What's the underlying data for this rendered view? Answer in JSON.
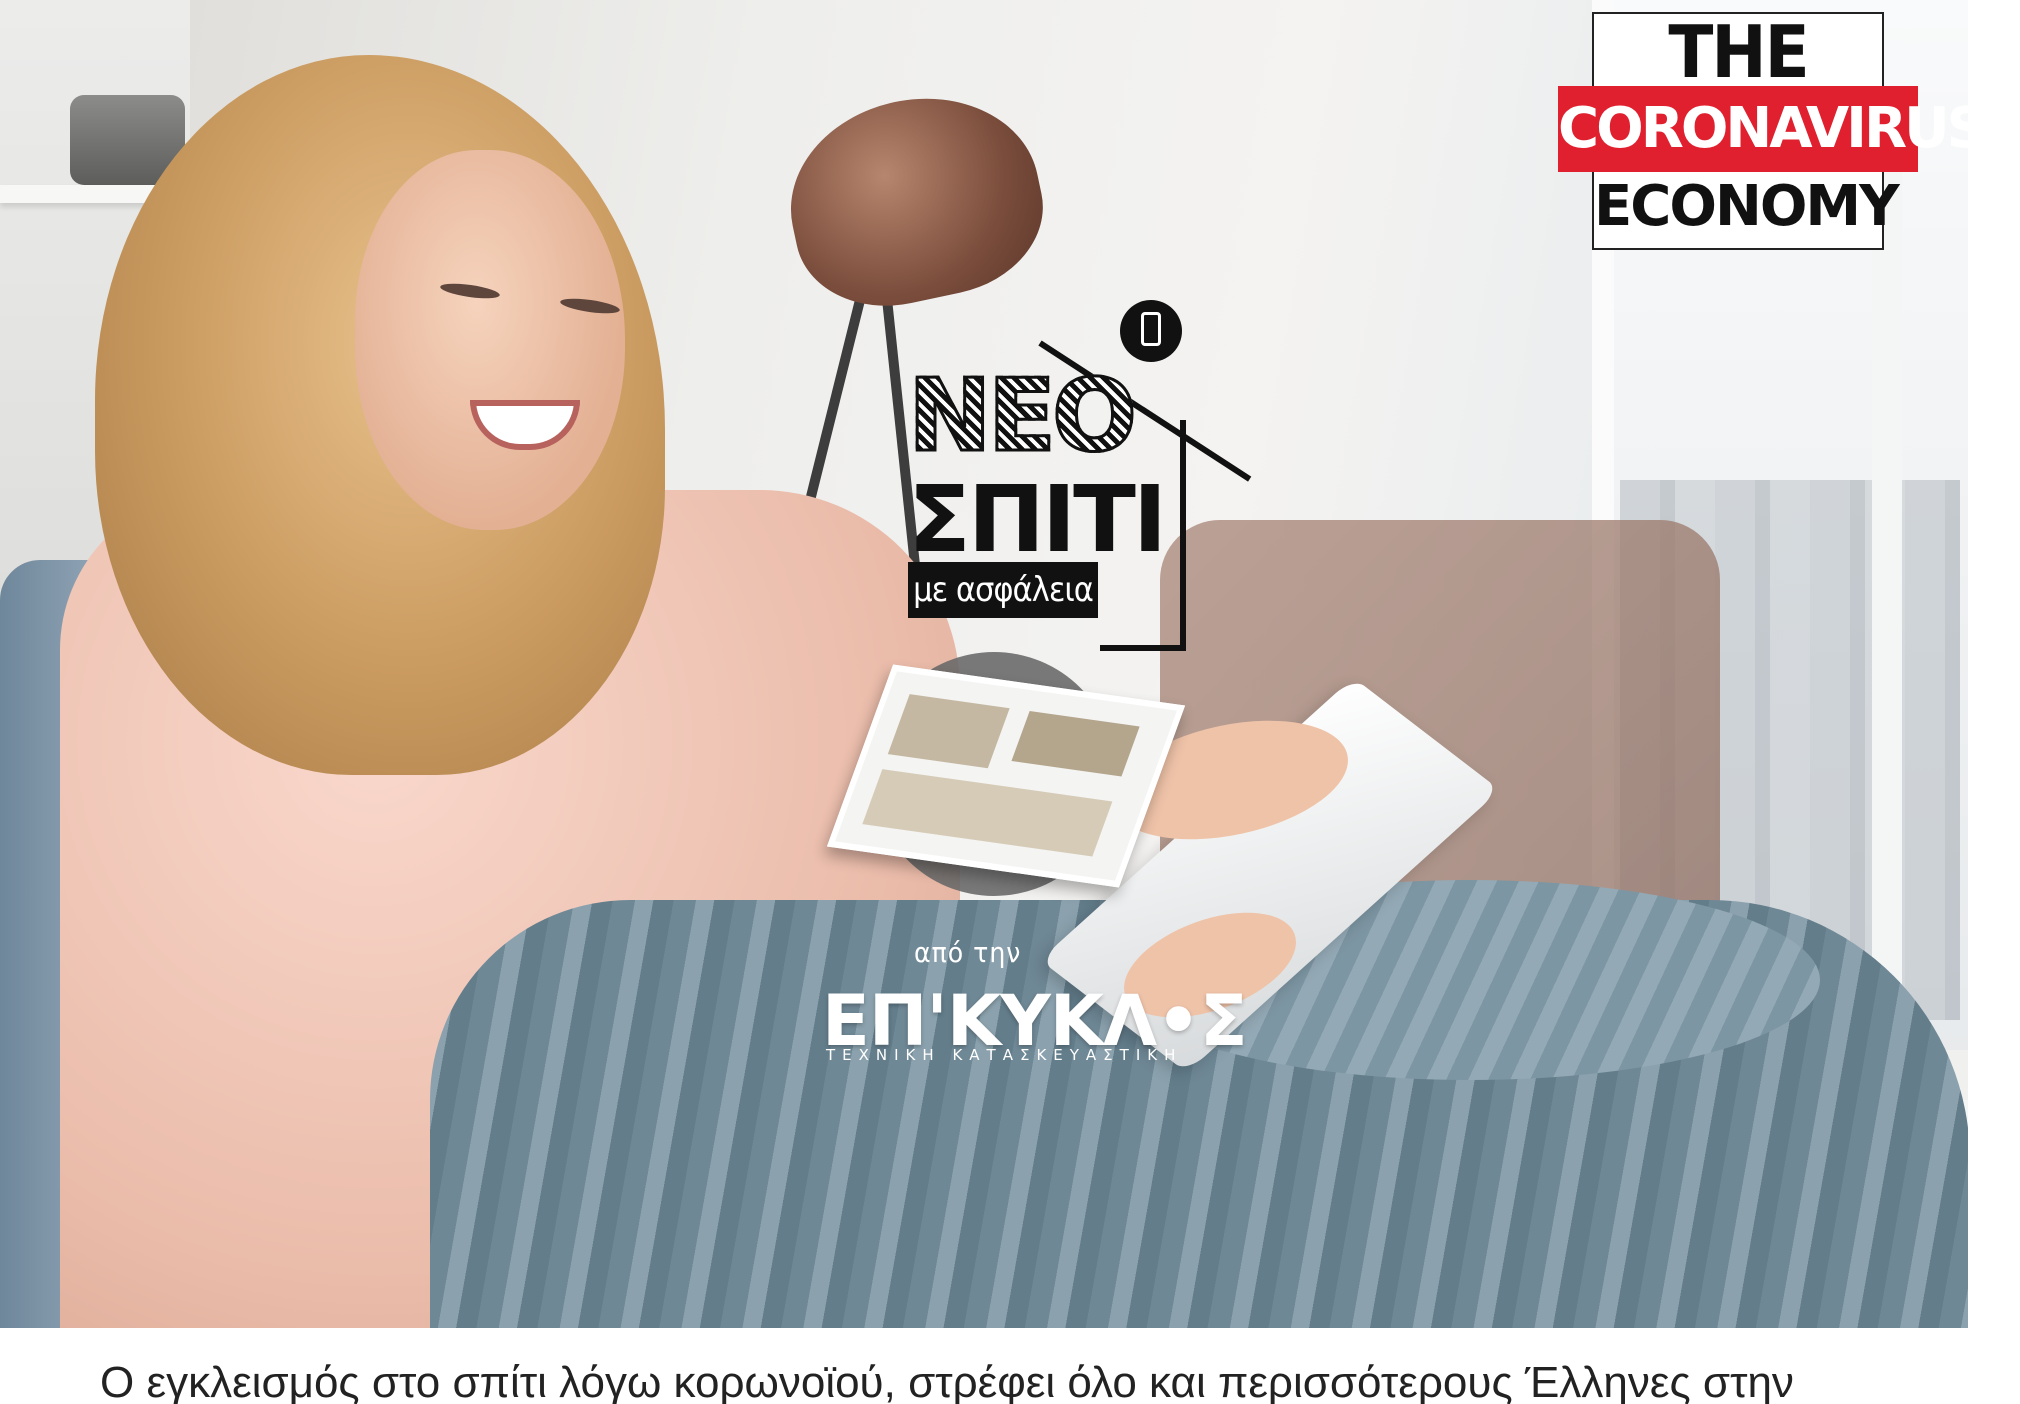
{
  "badge": {
    "line1": "THE",
    "line2": "CORONAVIRUS",
    "line3": "ECONOMY",
    "accent_color": "#e0202e"
  },
  "logo": {
    "title_line1": "ΝΕΟ",
    "title_line2": "ΣΠΙΤΙ",
    "tagline": "με ασφάλεια",
    "icon": "phone-icon"
  },
  "brand": {
    "prefix": "από την",
    "name": "ΕΠ'ΚΥΚΛ•Σ",
    "subtitle": "ΤΕΧΝΙΚΗ ΚΑΤΑΣΚΕΥΑΣΤΙΚΗ"
  },
  "article": {
    "lead_partial": "Ο εγκλεισμός στο σπίτι λόγω κορωνοϊού, στρέφει όλο και περισσότερους Έλληνες στην"
  }
}
